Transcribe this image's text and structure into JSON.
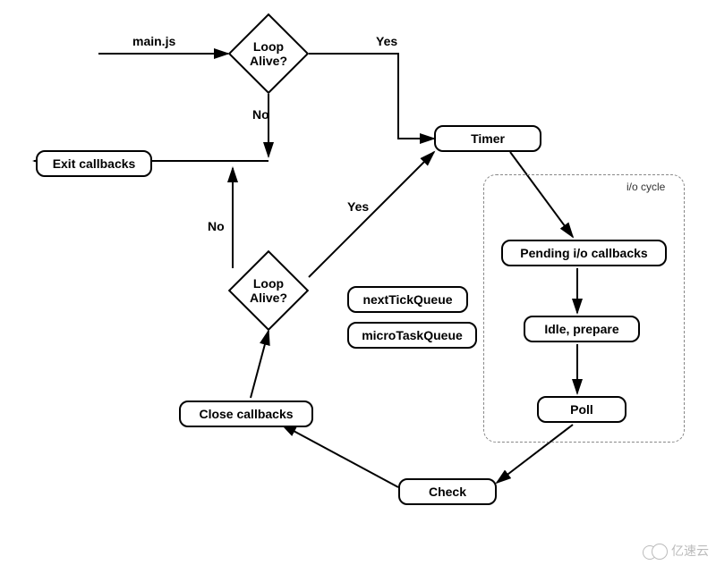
{
  "entry_label": "main.js",
  "decision_top": "Loop\nAlive?",
  "decision_bottom": "Loop\nAlive?",
  "branch_yes_top": "Yes",
  "branch_no_top": "No",
  "branch_yes_bottom": "Yes",
  "branch_no_bottom": "No",
  "nodes": {
    "exit_callbacks": "Exit callbacks",
    "timer": "Timer",
    "pending_io": "Pending i/o callbacks",
    "idle_prepare": "Idle, prepare",
    "poll": "Poll",
    "check": "Check",
    "close_callbacks": "Close callbacks",
    "next_tick_queue": "nextTickQueue",
    "micro_task_queue": "microTaskQueue"
  },
  "group_label": "i/o cycle",
  "watermark": "亿速云"
}
